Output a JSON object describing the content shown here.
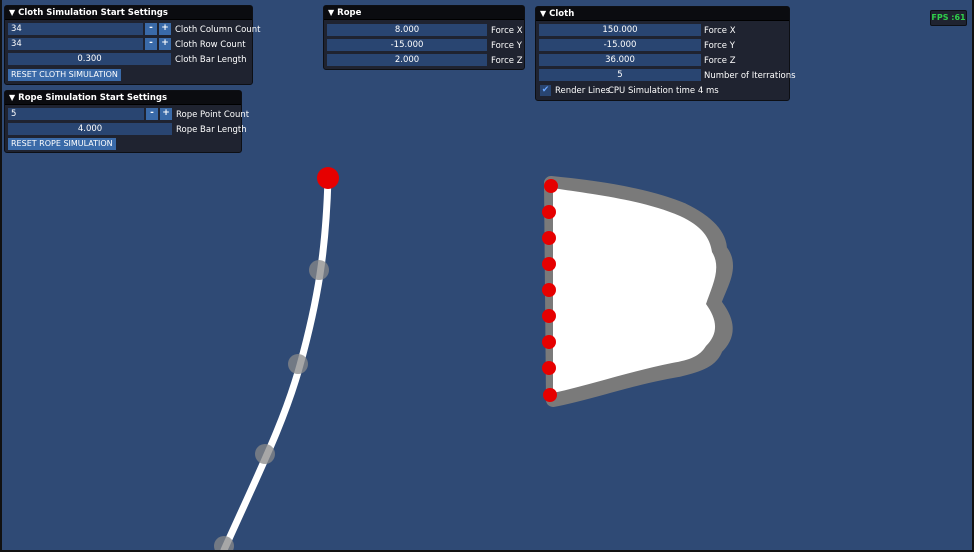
{
  "cloth_settings": {
    "title": "Cloth Simulation Start Settings",
    "column_count_value": "34",
    "column_count_label": "Cloth Column Count",
    "row_count_value": "34",
    "row_count_label": "Cloth Row Count",
    "bar_length_value": "0.300",
    "bar_length_label": "Cloth Bar Length",
    "reset_label": "RESET CLOTH SIMULATION",
    "minus": "-",
    "plus": "+"
  },
  "rope_settings": {
    "title": "Rope Simulation Start Settings",
    "point_count_value": "5",
    "point_count_label": "Rope Point Count",
    "bar_length_value": "4.000",
    "bar_length_label": "Rope Bar Length",
    "reset_label": "RESET ROPE SIMULATION",
    "minus": "-",
    "plus": "+"
  },
  "rope": {
    "title": "Rope",
    "force_x_value": "8.000",
    "force_x_label": "Force X",
    "force_y_value": "-15.000",
    "force_y_label": "Force Y",
    "force_z_value": "2.000",
    "force_z_label": "Force Z"
  },
  "cloth": {
    "title": "Cloth",
    "force_x_value": "150.000",
    "force_x_label": "Force X",
    "force_y_value": "-15.000",
    "force_y_label": "Force Y",
    "force_z_value": "36.000",
    "force_z_label": "Force Z",
    "iterations_value": "5",
    "iterations_label": "Number of Iterrations",
    "render_lines_label": "Render Lines",
    "render_lines_checked": true,
    "cpu_time_text": "CPU Simulation time 4 ms"
  },
  "fps": {
    "text": "FPS :61"
  },
  "colors": {
    "background": "#2f4a75",
    "panel": "#1f2330",
    "field": "#294571",
    "button": "#3a6aa8",
    "pin": "#e60000",
    "rope": "#ffffff",
    "rope_joint": "#8a8a8a",
    "cloth": "#ffffff",
    "cloth_outline": "#7a7a7a",
    "fps_text": "#2fd04a"
  }
}
